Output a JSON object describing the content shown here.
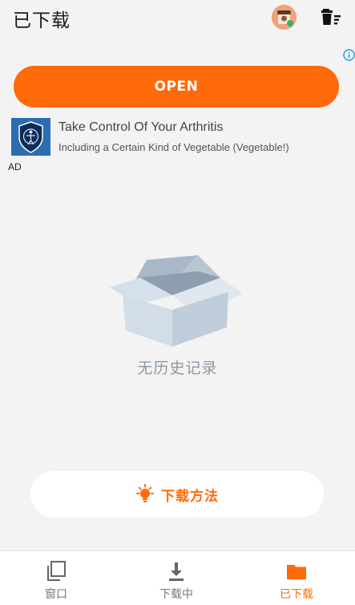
{
  "header": {
    "title": "已下载",
    "avatar_icon": "avatar-icon",
    "trash_icon": "trash-list-icon"
  },
  "ad": {
    "info_icon": "info-icon",
    "cta_label": "OPEN",
    "title": "Take Control Of Your Arthritis",
    "subtitle": "Including a Certain Kind of Vegetable (Vegetable!)",
    "ad_tag": "AD"
  },
  "empty_state": {
    "icon": "empty-box-icon",
    "message": "无历史记录"
  },
  "howto": {
    "label": "下载方法",
    "icon": "lightbulb-icon"
  },
  "nav": {
    "items": [
      {
        "label": "窗口",
        "icon": "windows-icon",
        "active": false
      },
      {
        "label": "下载中",
        "icon": "download-icon",
        "active": false
      },
      {
        "label": "已下载",
        "icon": "folder-icon",
        "active": true
      }
    ]
  },
  "colors": {
    "accent": "#ff6a0a",
    "background": "#f3f3f3",
    "empty_text": "#8c98a6"
  }
}
